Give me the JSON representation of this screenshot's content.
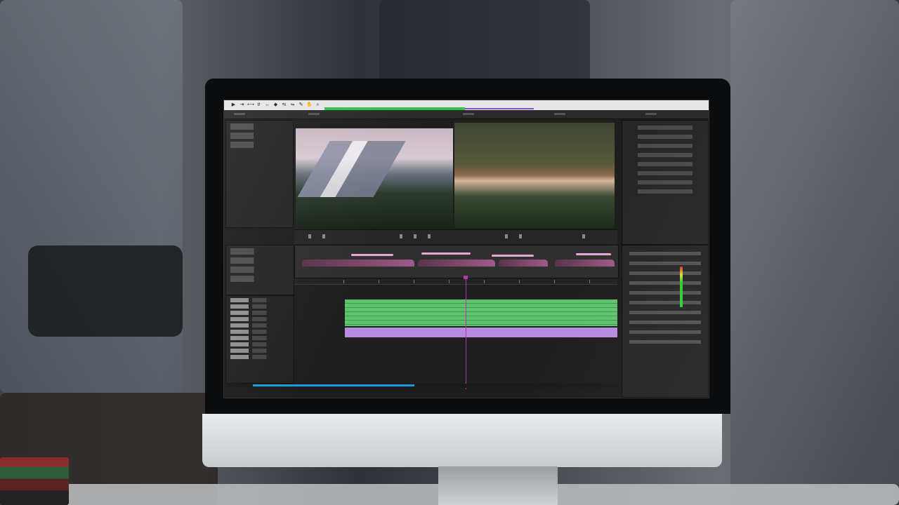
{
  "app": {
    "title": "",
    "toolbar_icons": [
      "select-icon",
      "track-select-icon",
      "ripple-edit-icon",
      "rolling-edit-icon",
      "rate-stretch-icon",
      "razor-icon",
      "slip-icon",
      "slide-icon",
      "pen-icon",
      "hand-icon",
      "zoom-icon"
    ]
  },
  "viewer": {
    "source_clip": "mountain-landscape",
    "program_clip": "forest-river"
  },
  "timeline": {
    "playhead_position": 0.53,
    "scroll_position": 0.07,
    "scroll_thumb_fraction": 0.41
  },
  "colors": {
    "video_clip": "#5fc26e",
    "audio_clip": "#b88ae0",
    "playhead": "#b03aa8",
    "workspace_bar": "#33c24a",
    "scroll_thumb": "#1d9bd6"
  }
}
